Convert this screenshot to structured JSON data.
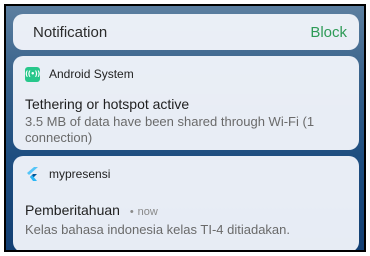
{
  "header": {
    "title": "Notification",
    "block_label": "Block"
  },
  "android_notification": {
    "source_name": "Android System",
    "icon": "hotspot-icon",
    "title": "Tethering or hotspot active",
    "body": "3.5 MB of data have been shared through Wi-Fi (1 connection)"
  },
  "app_notification": {
    "source_name": "mypresensi",
    "icon": "flutter-icon",
    "title": "Pemberitahuan",
    "time_separator": "•",
    "time": "now",
    "body": "Kelas bahasa indonesia kelas TI-4 ditiadakan."
  },
  "colors": {
    "accent": "#2e9b57",
    "hotspot_icon_bg": "#27c78b",
    "flutter_blue": "#42a5f5"
  }
}
